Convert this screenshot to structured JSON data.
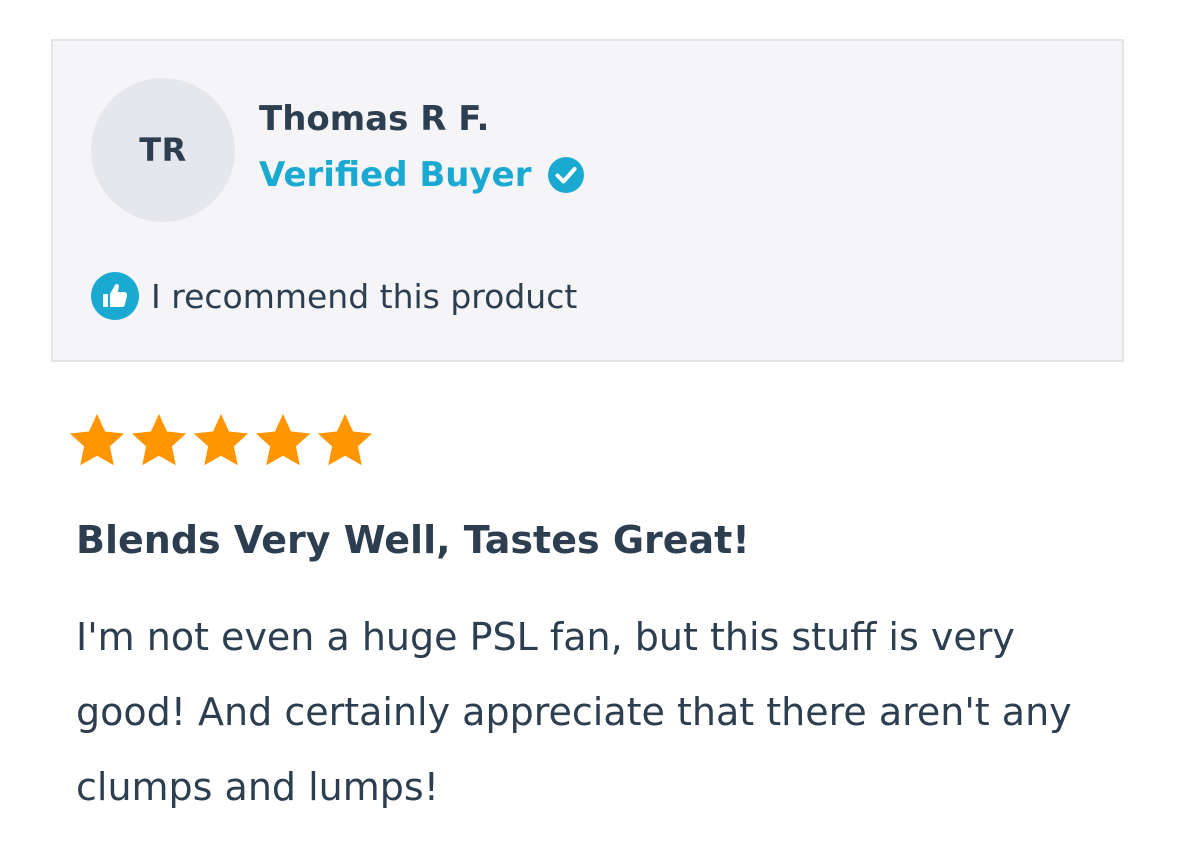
{
  "reviewer": {
    "initials": "TR",
    "name": "Thomas R F.",
    "verified_label": "Verified Buyer",
    "verified_icon": "verified-check-icon",
    "recommend_icon": "thumbs-up-icon",
    "recommend_text": "I recommend this product"
  },
  "review": {
    "rating": 5,
    "max_rating": 5,
    "title": "Blends Very Well, Tastes Great!",
    "body": "I'm not even a huge PSL fan, but this stuff is very good! And certainly appreciate that there aren't any clumps and lumps!"
  },
  "colors": {
    "accent": "#1aa9d1",
    "star": "#ff9500",
    "text": "#2c3e50",
    "card_bg": "#f5f5f8",
    "avatar_bg": "#e6e6ed"
  }
}
